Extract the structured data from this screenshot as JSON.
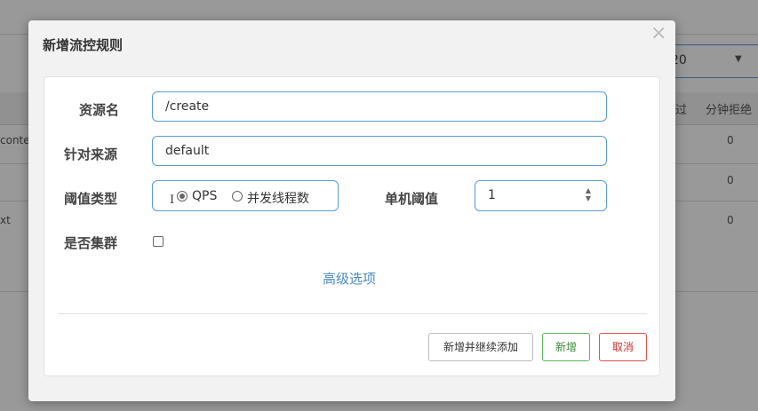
{
  "background": {
    "page_size_select": {
      "value": "20"
    },
    "table_headers": [
      "过",
      "分钟拒绝"
    ],
    "row_labels": [
      "conte",
      "xt"
    ],
    "row_values": [
      "0",
      "0",
      "0"
    ]
  },
  "modal": {
    "title": "新增流控规则",
    "close_glyph": "×",
    "form": {
      "resource_label": "资源名",
      "resource_value": "/create",
      "source_label": "针对来源",
      "source_value": "default",
      "threshold_type_label": "阈值类型",
      "threshold_type_options": [
        {
          "label": "QPS",
          "checked": true
        },
        {
          "label": "并发线程数",
          "checked": false
        }
      ],
      "single_threshold_label": "单机阈值",
      "single_threshold_value": "1",
      "cluster_label": "是否集群",
      "cluster_checked": false,
      "advanced_link": "高级选项"
    },
    "buttons": {
      "add_continue": "新增并继续添加",
      "add": "新增",
      "cancel": "取消"
    }
  },
  "colors": {
    "accent_blue": "#5b9bd5",
    "link_blue": "#4a8bc2",
    "success_green": "#5cb85c",
    "danger_red": "#d9534f"
  }
}
